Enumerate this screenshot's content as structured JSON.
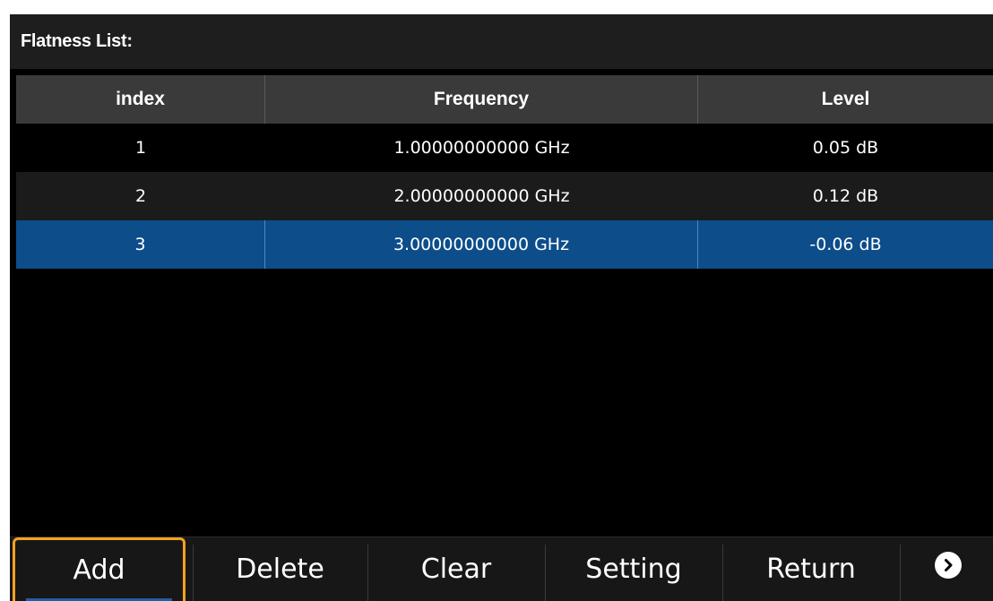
{
  "title": "Flatness List:",
  "table": {
    "headers": {
      "index": "index",
      "frequency": "Frequency",
      "level": "Level"
    },
    "rows": [
      {
        "index": "1",
        "frequency": "1.00000000000 GHz",
        "level": "0.05 dB"
      },
      {
        "index": "2",
        "frequency": "2.00000000000 GHz",
        "level": "0.12 dB"
      },
      {
        "index": "3",
        "frequency": "3.00000000000 GHz",
        "level": "-0.06 dB"
      }
    ],
    "selected_row": 3
  },
  "softkeys": {
    "add": "Add",
    "delete": "Delete",
    "clear": "Clear",
    "setting": "Setting",
    "return": "Return",
    "more_icon": "chevron-right-circle-icon"
  },
  "colors": {
    "selected_row": "#0d4d8a",
    "active_key_border": "#f4a21f",
    "header_bg": "#3a3a3a"
  }
}
